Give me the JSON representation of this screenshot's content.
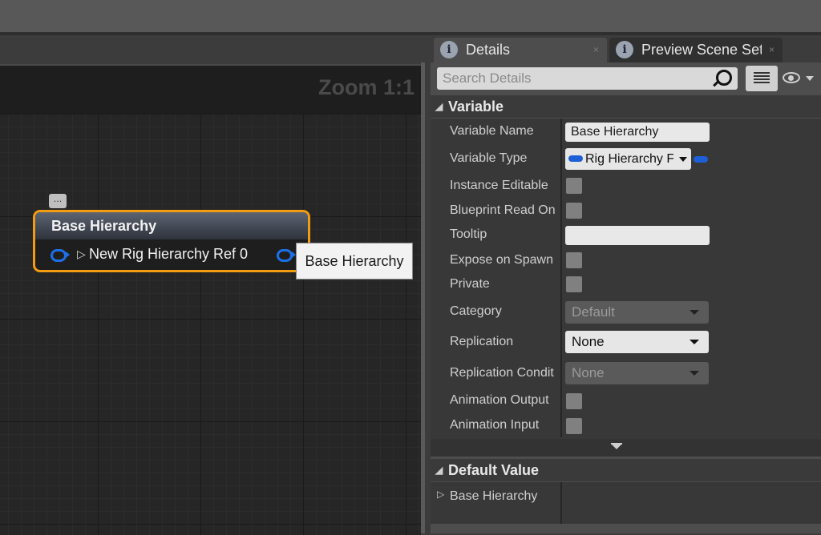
{
  "graph": {
    "zoom_label": "Zoom 1:1",
    "comment_bubble": "...",
    "node": {
      "title": "Base Hierarchy",
      "pin_label": "New Rig Hierarchy Ref 0"
    },
    "tooltip": "Base Hierarchy"
  },
  "tabs": [
    {
      "label": "Details",
      "icon": "info-icon",
      "active": true
    },
    {
      "label": "Preview Scene Setti",
      "icon": "info-icon",
      "active": false
    }
  ],
  "search": {
    "placeholder": "Search Details"
  },
  "sections": {
    "variable": "Variable",
    "default_value": "Default Value"
  },
  "properties": {
    "variable_name": {
      "label": "Variable Name",
      "value": "Base Hierarchy"
    },
    "variable_type": {
      "label": "Variable Type",
      "value": "Rig Hierarchy F"
    },
    "instance_editable": {
      "label": "Instance Editable"
    },
    "blueprint_read_only": {
      "label": "Blueprint Read On"
    },
    "tooltip": {
      "label": "Tooltip",
      "value": ""
    },
    "expose_on_spawn": {
      "label": "Expose on Spawn"
    },
    "private": {
      "label": "Private"
    },
    "category": {
      "label": "Category",
      "value": "Default"
    },
    "replication": {
      "label": "Replication",
      "value": "None"
    },
    "replication_condition": {
      "label": "Replication Condit",
      "value": "None"
    },
    "animation_output": {
      "label": "Animation Output"
    },
    "animation_input": {
      "label": "Animation Input"
    }
  },
  "default_value": {
    "label": "Base Hierarchy"
  },
  "colors": {
    "node_border": "#f39c11",
    "pin": "#1d6fe8",
    "panel_bg": "#4d4d4d"
  }
}
